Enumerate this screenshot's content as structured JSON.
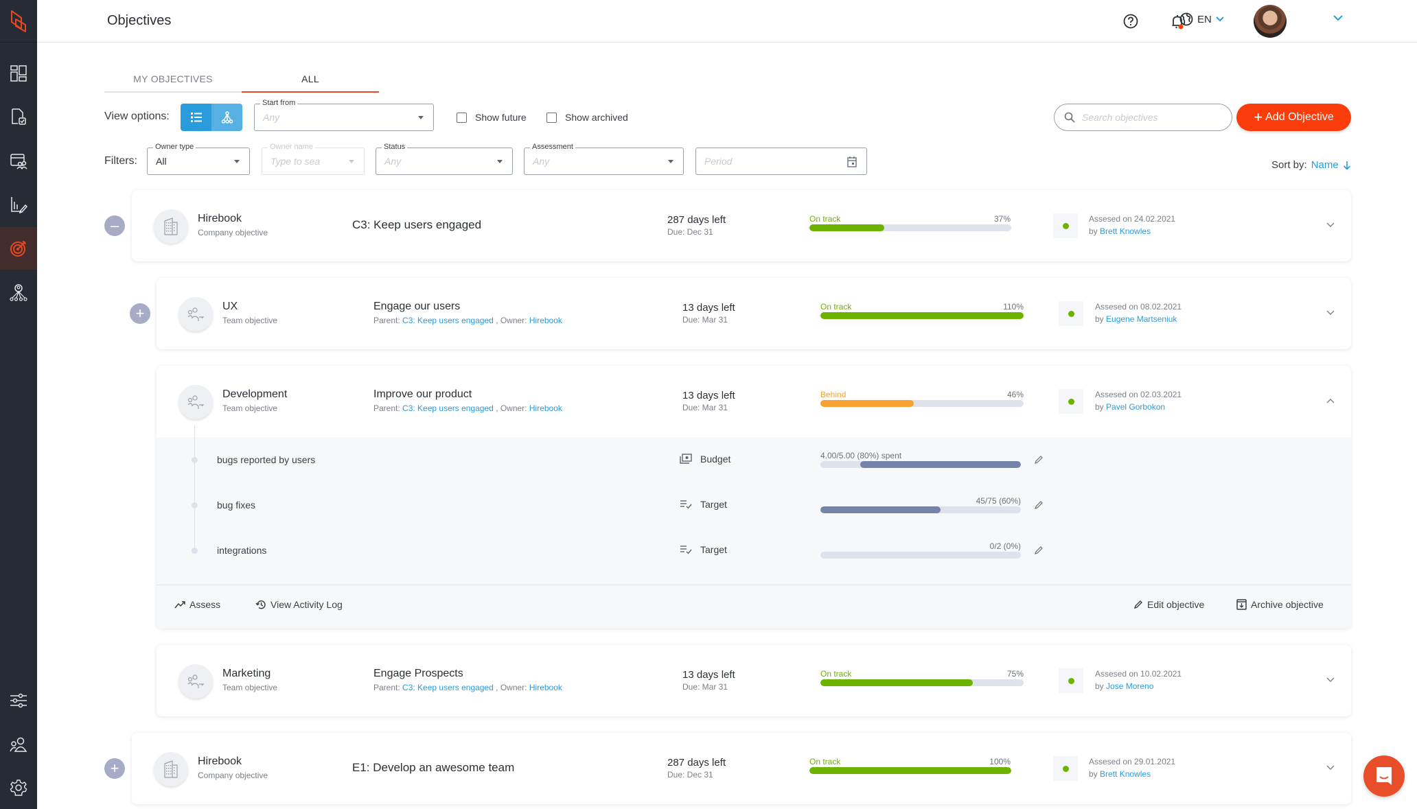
{
  "header": {
    "title": "Objectives",
    "language": "EN",
    "icons": {
      "help": "help-circle-icon",
      "notifications": "bell-icon",
      "language": "globe-icon"
    }
  },
  "sidebar": {
    "items": [
      {
        "name": "dashboard",
        "icon": "dashboard-icon"
      },
      {
        "name": "reviews",
        "icon": "document-check-icon"
      },
      {
        "name": "meetings",
        "icon": "calendar-people-icon"
      },
      {
        "name": "reports",
        "icon": "chart-edit-icon"
      },
      {
        "name": "objectives",
        "icon": "target-icon",
        "active": true
      },
      {
        "name": "org-chart",
        "icon": "org-chart-icon"
      },
      {
        "name": "settings-sliders",
        "icon": "sliders-icon"
      },
      {
        "name": "people",
        "icon": "people-icon"
      },
      {
        "name": "settings",
        "icon": "gear-icon"
      }
    ]
  },
  "tabs": [
    {
      "label": "MY OBJECTIVES",
      "active": false
    },
    {
      "label": "ALL",
      "active": true
    }
  ],
  "view_options": {
    "label": "View options:",
    "start_from": {
      "label": "Start from",
      "placeholder": "Any"
    },
    "show_future": {
      "label": "Show future",
      "checked": false
    },
    "show_archived": {
      "label": "Show archived",
      "checked": false
    }
  },
  "search": {
    "placeholder": "Search objectives"
  },
  "add_button": {
    "label": "Add Objective"
  },
  "filters": {
    "label": "Filters:",
    "owner_type": {
      "label": "Owner type",
      "value": "All"
    },
    "owner_name": {
      "label": "Owner name",
      "placeholder": "Type to sea"
    },
    "status": {
      "label": "Status",
      "placeholder": "Any"
    },
    "assessment": {
      "label": "Assessment",
      "placeholder": "Any"
    },
    "period": {
      "placeholder": "Period"
    }
  },
  "sort": {
    "label": "Sort by:",
    "value": "Name"
  },
  "objectives": [
    {
      "owner": "Hirebook",
      "owner_type": "Company objective",
      "title": "C3: Keep users engaged",
      "days_left": "287 days left",
      "due": "Due: Dec 31",
      "status": "On track",
      "progress_label": "37%",
      "progress": 37,
      "status_color": "#6cb300",
      "assessed": "Assesed on 24.02.2021",
      "by_prefix": "by",
      "assessor": "Brett Knowles"
    },
    {
      "owner": "UX",
      "owner_type": "Team objective",
      "title": "Engage our users",
      "parent_prefix": "Parent:",
      "parent": "C3: Keep users engaged",
      "owner_prefix": ", Owner:",
      "parent_owner": "Hirebook",
      "days_left": "13 days left",
      "due": "Due: Mar 31",
      "status": "On track",
      "progress_label": "110%",
      "progress": 100,
      "status_color": "#6cb300",
      "assessed": "Assesed on 08.02.2021",
      "by_prefix": "by",
      "assessor": "Eugene Martseniuk"
    },
    {
      "owner": "Development",
      "owner_type": "Team objective",
      "title": "Improve our product",
      "parent_prefix": "Parent:",
      "parent": "C3: Keep users engaged",
      "owner_prefix": ", Owner:",
      "parent_owner": "Hirebook",
      "days_left": "13 days left",
      "due": "Due: Mar 31",
      "status": "Behind",
      "progress_label": "46%",
      "progress": 46,
      "status_color": "#f7a130",
      "assessed": "Assesed on 02.03.2021",
      "by_prefix": "by",
      "assessor": "Pavel Gorbokon",
      "key_results": [
        {
          "name": "bugs reported by users",
          "type": "Budget",
          "type_icon": "budget-icon",
          "label": "4.00/5.00 (80%) spent",
          "progress": 80,
          "fill_from": "right"
        },
        {
          "name": "bug fixes",
          "type": "Target",
          "type_icon": "target-list-icon",
          "label": "45/75 (60%)",
          "progress": 60,
          "fill_from": "left"
        },
        {
          "name": "integrations",
          "type": "Target",
          "type_icon": "target-list-icon",
          "label": "0/2 (0%)",
          "progress": 0,
          "fill_from": "left"
        }
      ],
      "actions": {
        "assess": "Assess",
        "activity": "View Activity Log",
        "edit": "Edit objective",
        "archive": "Archive objective"
      }
    },
    {
      "owner": "Marketing",
      "owner_type": "Team objective",
      "title": "Engage Prospects",
      "parent_prefix": "Parent:",
      "parent": "C3: Keep users engaged",
      "owner_prefix": ", Owner:",
      "parent_owner": "Hirebook",
      "days_left": "13 days left",
      "due": "Due: Mar 31",
      "status": "On track",
      "progress_label": "75%",
      "progress": 75,
      "status_color": "#6cb300",
      "assessed": "Assesed on 10.02.2021",
      "by_prefix": "by",
      "assessor": "Jose Moreno"
    },
    {
      "owner": "Hirebook",
      "owner_type": "Company objective",
      "title": "E1: Develop an awesome team",
      "days_left": "287 days left",
      "due": "Due: Dec 31",
      "status": "On track",
      "progress_label": "100%",
      "progress": 100,
      "status_color": "#6cb300",
      "assessed": "Assesed on 29.01.2021",
      "by_prefix": "by",
      "assessor": "Brett Knowles"
    }
  ],
  "colors": {
    "accent": "#fa3d0a",
    "link": "#2a9bdb",
    "on_track": "#6cb300",
    "behind": "#f7a130",
    "kr_fill": "#7583a8"
  }
}
